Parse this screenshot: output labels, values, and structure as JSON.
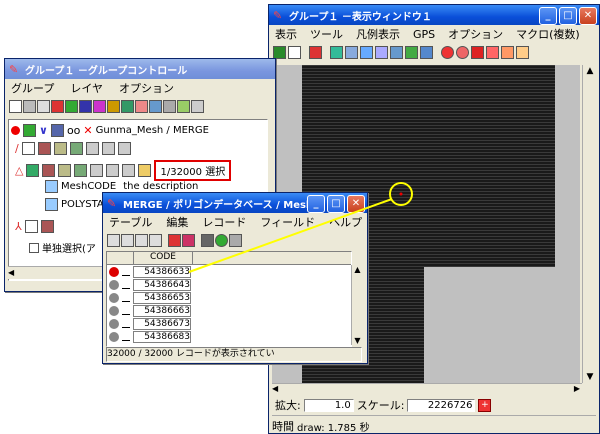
{
  "display_window": {
    "title": "グループ１ －表示ウィンドウ１",
    "menu": [
      "表示",
      "ツール",
      "凡例表示",
      "GPS",
      "オプション",
      "マクロ(複数)"
    ],
    "zoom_label": "拡大:",
    "zoom_value": "1.0",
    "scale_label": "スケール:",
    "scale_value": "2226726",
    "status_label": "時間",
    "status_text": "draw: 1.785 秒"
  },
  "group_control": {
    "title": "グループ１ －グループコントロール",
    "menu": [
      "グループ",
      "レイヤ",
      "オプション"
    ],
    "layer_name": "Gunma_Mesh / MERGE",
    "selection_count": "1/32000 選択",
    "field_rows": [
      {
        "field": "MeshCODE",
        "desc": "the description"
      },
      {
        "field": "POLYSTATS",
        "desc": ""
      }
    ],
    "single_select_label": "単独選択(ア"
  },
  "table_window": {
    "title": "MERGE / ポリゴンデータベース / Mesh...",
    "menu": [
      "テーブル",
      "編集",
      "レコード",
      "フィールド",
      "ヘルプ"
    ],
    "column_header": "CODE",
    "records": [
      "54386633",
      "54386643",
      "54386653",
      "54386663",
      "54386673",
      "54386683"
    ],
    "status": "32000 / 32000 レコードが表示されてい"
  },
  "colors": {
    "titlebar_active": "#0a4fd9",
    "map_bg": "#c0c0c0",
    "map_fill": "#1e1e1e",
    "highlight": "#ffff00",
    "selection_box": "#e00000"
  }
}
